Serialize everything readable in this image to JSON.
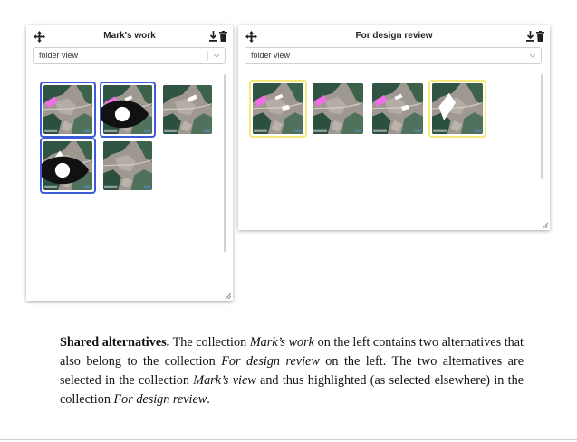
{
  "collections": [
    {
      "title": "Mark's work",
      "view_select": {
        "value": "folder view"
      },
      "thumbs": [
        {
          "selected": true,
          "elsewhere": false,
          "eye": false,
          "overlay": "pink"
        },
        {
          "selected": true,
          "elsewhere": false,
          "eye": true,
          "overlay": "pink-white"
        },
        {
          "selected": false,
          "elsewhere": false,
          "eye": false,
          "overlay": "white-small"
        },
        {
          "selected": true,
          "elsewhere": false,
          "eye": true,
          "overlay": "white-diamond"
        },
        {
          "selected": false,
          "elsewhere": false,
          "eye": false,
          "overlay": "none"
        }
      ]
    },
    {
      "title": "For design review",
      "view_select": {
        "value": "folder view"
      },
      "thumbs": [
        {
          "selected": false,
          "elsewhere": true,
          "eye": false,
          "overlay": "pink-white"
        },
        {
          "selected": false,
          "elsewhere": false,
          "eye": false,
          "overlay": "pink"
        },
        {
          "selected": false,
          "elsewhere": false,
          "eye": false,
          "overlay": "pink-white"
        },
        {
          "selected": false,
          "elsewhere": true,
          "eye": false,
          "overlay": "white-diamond"
        }
      ]
    }
  ],
  "icons": {
    "move": "move-arrows-icon",
    "download": "download-icon",
    "trash": "trash-icon",
    "chevron": "chevron-down-icon",
    "eye": "eye-icon"
  },
  "colors": {
    "selected_border": "#3b5bd9",
    "selected_elsewhere_border": "#f4e97a",
    "pink_overlay": "#f06ee6"
  },
  "caption": {
    "lead": "Shared alternatives.",
    "t1": " The collection ",
    "i1": "Mark’s work",
    "t2": " on the left contains two alternatives that also belong to the collection ",
    "i2": "For design review",
    "t3": " on the left. The two alternatives are selected in the collection ",
    "i3": "Mark’s view",
    "t4": " and thus highlighted (as selected elsewhere) in the collection ",
    "i4": "For design review",
    "t5": "."
  }
}
